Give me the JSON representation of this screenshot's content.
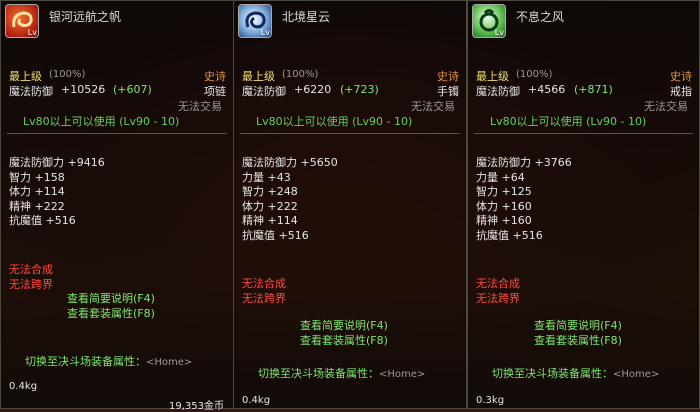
{
  "colors": {
    "gold": "#f0e070",
    "green": "#62d25a",
    "red": "#ff4a3a",
    "orange": "#e09040"
  },
  "panels": [
    {
      "icon": "red-swirl-icon",
      "icon_level": "Lv",
      "name": "银河远航之帆",
      "grade": "最上级",
      "grade_pct": "(100%)",
      "rarity": "史诗",
      "defense_label": "魔法防御",
      "defense_value": "+10526",
      "defense_bonus": "(+607)",
      "slot": "项链",
      "trade": "无法交易",
      "level_req": "Lv80以上可以使用 (Lv90 - 10)",
      "stats": [
        "魔法防御力 +9416",
        "智力 +158",
        "体力 +114",
        "精神 +222",
        "抗魔值 +516"
      ],
      "restrictions": [
        "无法合成",
        "无法跨界"
      ],
      "links": [
        "查看简要说明(F4)",
        "查看套装属性(F8)"
      ],
      "switch": "切换至决斗场装备属性：",
      "switch_key": "<Home>",
      "weight": "0.4kg",
      "price": "19,353金币"
    },
    {
      "icon": "blue-swirl-icon",
      "icon_level": "Lv",
      "name": "北境星云",
      "grade": "最上级",
      "grade_pct": "(100%)",
      "rarity": "史诗",
      "defense_label": "魔法防御",
      "defense_value": "+6220",
      "defense_bonus": "(+723)",
      "slot": "手镯",
      "trade": "无法交易",
      "level_req": "Lv80以上可以使用 (Lv90 - 10)",
      "stats": [
        "魔法防御力 +5650",
        "力量 +43",
        "智力 +248",
        "体力 +222",
        "精神 +114",
        "抗魔值 +516"
      ],
      "restrictions": [
        "无法合成",
        "无法跨界"
      ],
      "links": [
        "查看简要说明(F4)",
        "查看套装属性(F8)"
      ],
      "switch": "切换至决斗场装备属性：",
      "switch_key": "<Home>",
      "weight": "0.4kg",
      "price": ""
    },
    {
      "icon": "green-swirl-icon",
      "icon_level": "Lv",
      "name": "不息之风",
      "grade": "最上级",
      "grade_pct": "(100%)",
      "rarity": "史诗",
      "defense_label": "魔法防御",
      "defense_value": "+4566",
      "defense_bonus": "(+871)",
      "slot": "戒指",
      "trade": "无法交易",
      "level_req": "Lv80以上可以使用 (Lv90 - 10)",
      "stats": [
        "魔法防御力 +3766",
        "力量 +64",
        "智力 +125",
        "体力 +160",
        "精神 +160",
        "抗魔值 +516"
      ],
      "restrictions": [
        "无法合成",
        "无法跨界"
      ],
      "links": [
        "查看简要说明(F4)",
        "查看套装属性(F8)"
      ],
      "switch": "切换至决斗场装备属性：",
      "switch_key": "<Home>",
      "weight": "0.3kg",
      "price": ""
    }
  ]
}
